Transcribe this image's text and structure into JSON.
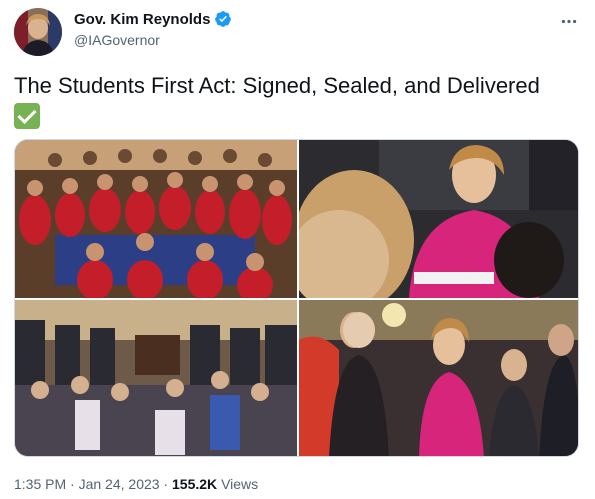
{
  "account": {
    "display_name": "Gov. Kim Reynolds",
    "handle": "@IAGovernor",
    "verified_icon": "verified-badge-icon",
    "brand_color": "#1d9bf0"
  },
  "tweet": {
    "text": "The Students First Act: Signed, Sealed, and Delivered",
    "emoji": "check-mark-button-icon"
  },
  "media": {
    "photos": [
      {
        "name": "students-group-photo"
      },
      {
        "name": "signing-photo"
      },
      {
        "name": "capitol-rotunda-photo"
      },
      {
        "name": "celebration-photo"
      }
    ]
  },
  "meta": {
    "time": "1:35 PM",
    "separator": "·",
    "date": "Jan 24, 2023",
    "views_count": "155.2K",
    "views_label": "Views"
  }
}
